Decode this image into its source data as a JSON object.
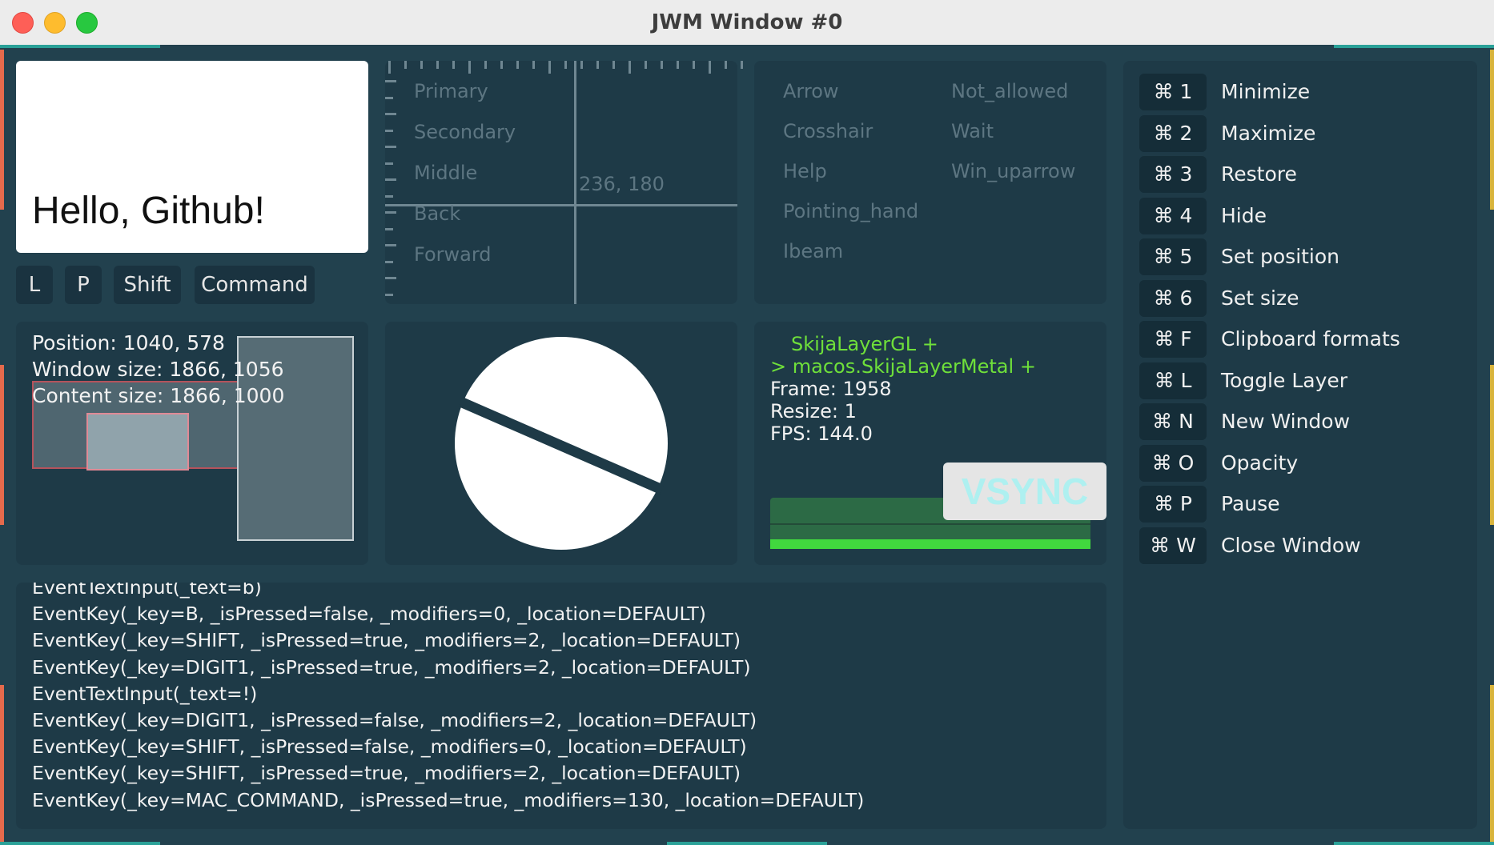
{
  "window": {
    "title": "JWM Window #0"
  },
  "hello": {
    "text": "Hello, Github!"
  },
  "modifier_keys": [
    "L",
    "P",
    "Shift",
    "Command"
  ],
  "mouse": {
    "buttons": [
      "Primary",
      "Secondary",
      "Middle",
      "Back",
      "Forward"
    ],
    "coords": "236, 180"
  },
  "cursors": {
    "left": [
      "Arrow",
      "Crosshair",
      "Help",
      "Pointing_hand",
      "Ibeam"
    ],
    "right": [
      "Not_allowed",
      "Wait",
      "Win_uparrow"
    ]
  },
  "geometry": {
    "position": "Position: 1040, 578",
    "window_size": "Window size: 1866, 1056",
    "content_size": "Content size: 1866, 1000"
  },
  "layer": {
    "line1": "SkijaLayerGL +",
    "line2": "> macos.SkijaLayerMetal +",
    "frame": "Frame: 1958",
    "resize": "Resize: 1",
    "fps": "FPS: 144.0",
    "vsync": "VSYNC",
    "accent": "#6fe03a"
  },
  "shortcuts": [
    {
      "key": "⌘ 1",
      "label": "Minimize"
    },
    {
      "key": "⌘ 2",
      "label": "Maximize"
    },
    {
      "key": "⌘ 3",
      "label": "Restore"
    },
    {
      "key": "⌘ 4",
      "label": "Hide"
    },
    {
      "key": "⌘ 5",
      "label": "Set position"
    },
    {
      "key": "⌘ 6",
      "label": "Set size"
    },
    {
      "key": "⌘ F",
      "label": "Clipboard formats"
    },
    {
      "key": "⌘ L",
      "label": "Toggle Layer"
    },
    {
      "key": "⌘ N",
      "label": "New Window"
    },
    {
      "key": "⌘ O",
      "label": "Opacity"
    },
    {
      "key": "⌘ P",
      "label": "Pause"
    },
    {
      "key": "⌘ W",
      "label": "Close Window"
    }
  ],
  "log": [
    "EventTextInput(_text=b)",
    "EventKey(_key=B, _isPressed=false, _modifiers=0, _location=DEFAULT)",
    "EventKey(_key=SHIFT, _isPressed=true, _modifiers=2, _location=DEFAULT)",
    "EventKey(_key=DIGIT1, _isPressed=true, _modifiers=2, _location=DEFAULT)",
    "EventTextInput(_text=!)",
    "EventKey(_key=DIGIT1, _isPressed=false, _modifiers=2, _location=DEFAULT)",
    "EventKey(_key=SHIFT, _isPressed=false, _modifiers=0, _location=DEFAULT)",
    "EventKey(_key=SHIFT, _isPressed=true, _modifiers=2, _location=DEFAULT)",
    "EventKey(_key=MAC_COMMAND, _isPressed=true, _modifiers=130, _location=DEFAULT)"
  ]
}
